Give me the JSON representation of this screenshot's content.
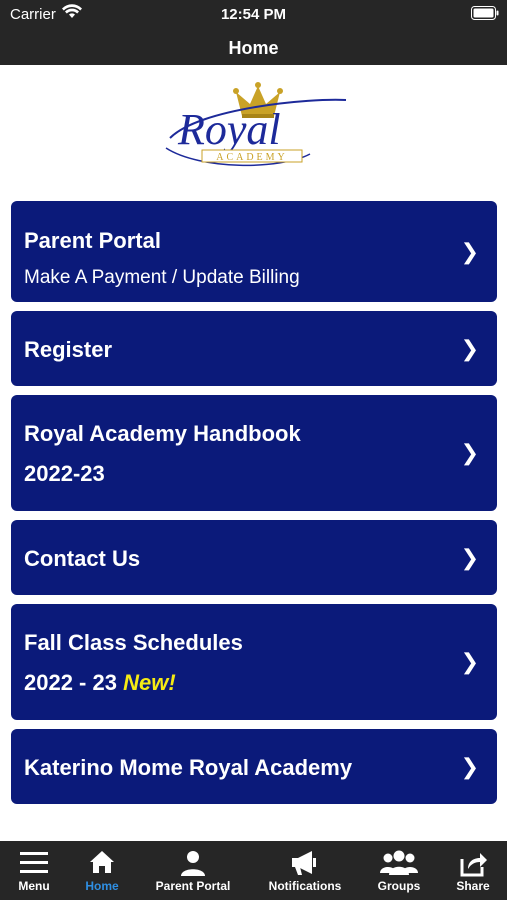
{
  "status_bar": {
    "carrier": "Carrier",
    "time": "12:54 PM"
  },
  "nav": {
    "title": "Home"
  },
  "logo": {
    "word": "Royal",
    "sub": "ACADEMY"
  },
  "cards": [
    {
      "title": "Parent Portal",
      "subtitle": "Make A Payment / Update Billing"
    },
    {
      "title": "Register"
    },
    {
      "title": "Royal Academy Handbook",
      "line2": "2022-23"
    },
    {
      "title": "Contact Us"
    },
    {
      "title": "Fall Class Schedules",
      "line2": "2022 - 23",
      "badge": "New!"
    },
    {
      "title": "Katerino Mome Royal Academy"
    }
  ],
  "chevron": "❯",
  "tabs": [
    {
      "label": "Menu",
      "icon": "menu-icon"
    },
    {
      "label": "Home",
      "icon": "home-icon"
    },
    {
      "label": "Parent Portal",
      "icon": "person-icon"
    },
    {
      "label": "Notifications",
      "icon": "megaphone-icon"
    },
    {
      "label": "Groups",
      "icon": "groups-icon"
    },
    {
      "label": "Share",
      "icon": "share-icon"
    }
  ],
  "colors": {
    "card": "#0b1a7a",
    "bar": "#262626",
    "active_tab": "#2f8fe3",
    "accent_new": "#f5ea14",
    "logo_blue": "#1d2a9a",
    "logo_gold": "#c9a227"
  }
}
